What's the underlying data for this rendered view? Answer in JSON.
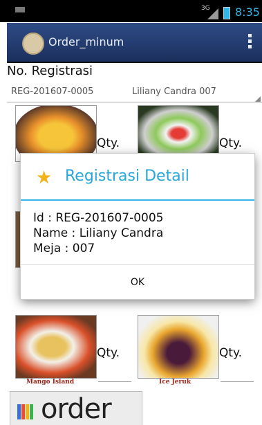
{
  "status_bar": {
    "network_label": "3G",
    "time": "8:35",
    "icons": [
      "notification-icon",
      "signal-icon",
      "battery-icon"
    ],
    "accent_color": "#33b5e5"
  },
  "action_bar": {
    "title": "Order_minum",
    "icons": [
      "app-logo-icon",
      "overflow-menu-icon"
    ]
  },
  "registration": {
    "label": "No. Registrasi",
    "selected_number": "REG-201607-0005",
    "selected_name": "Liliany Candra 007"
  },
  "menu_items": [
    {
      "qty_label": "Qty.",
      "name": ""
    },
    {
      "qty_label": "Qty.",
      "name": ""
    },
    {
      "qty_label": "Qty.",
      "name": "Mango Island"
    },
    {
      "qty_label": "Qty.",
      "name": "Ice Jeruk"
    }
  ],
  "order_button": {
    "label": "order",
    "bar_colors": [
      "#3a6fd8",
      "#e84c3a",
      "#f5b21f",
      "#3cb44a"
    ]
  },
  "dialog": {
    "title": "Registrasi Detail",
    "icon": "star-icon",
    "lines": {
      "id": "Id : REG-201607-0005",
      "name": "Name : Liliany Candra",
      "meja": "Meja : 007"
    },
    "ok_label": "OK",
    "title_color": "#2aa6d8"
  }
}
